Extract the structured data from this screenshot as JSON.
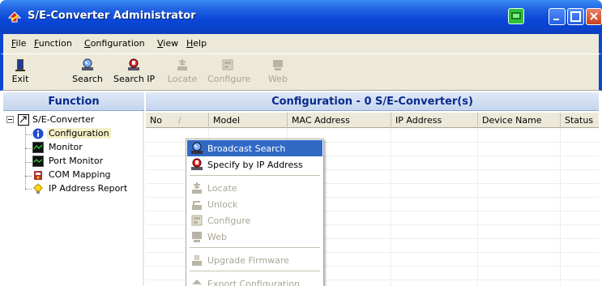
{
  "window": {
    "title": "S/E-Converter Administrator"
  },
  "menubar": {
    "items": [
      {
        "label": "File",
        "mnemonic": "F",
        "rest": "ile"
      },
      {
        "label": "Function",
        "mnemonic": "F",
        "rest": "unction"
      },
      {
        "label": "Configuration",
        "mnemonic": "C",
        "rest": "onfiguration"
      },
      {
        "label": "View",
        "mnemonic": "V",
        "rest": "iew"
      },
      {
        "label": "Help",
        "mnemonic": "H",
        "rest": "elp"
      }
    ]
  },
  "toolbar": {
    "buttons": [
      {
        "label": "Exit",
        "icon": "exit-icon",
        "enabled": true
      },
      {
        "label": "Search",
        "icon": "search-icon",
        "enabled": true
      },
      {
        "label": "Search IP",
        "icon": "search-ip-icon",
        "enabled": true
      },
      {
        "label": "Locate",
        "icon": "locate-icon",
        "enabled": false
      },
      {
        "label": "Configure",
        "icon": "configure-icon",
        "enabled": false
      },
      {
        "label": "Web",
        "icon": "web-icon",
        "enabled": false
      }
    ]
  },
  "function_pane": {
    "header": "Function",
    "tree": {
      "root": "S/E-Converter",
      "items": [
        {
          "label": "Configuration",
          "icon": "info-icon",
          "selected": true
        },
        {
          "label": "Monitor",
          "icon": "monitor-icon",
          "selected": false
        },
        {
          "label": "Port Monitor",
          "icon": "port-monitor-icon",
          "selected": false
        },
        {
          "label": "COM Mapping",
          "icon": "com-mapping-icon",
          "selected": false
        },
        {
          "label": "IP Address Report",
          "icon": "ip-report-icon",
          "selected": false
        }
      ]
    }
  },
  "config_pane": {
    "header": "Configuration - 0 S/E-Converter(s)",
    "columns": [
      "No",
      "Model",
      "MAC Address",
      "IP Address",
      "Device Name",
      "Status"
    ],
    "sort_indicator": "/"
  },
  "context_menu": {
    "items": [
      {
        "label": "Broadcast Search",
        "icon": "broadcast-search-icon",
        "enabled": true,
        "highlighted": true
      },
      {
        "label": "Specify by IP Address",
        "icon": "specify-ip-icon",
        "enabled": true,
        "highlighted": false
      },
      {
        "label": "Locate",
        "icon": "locate-icon",
        "enabled": false,
        "highlighted": false
      },
      {
        "label": "Unlock",
        "icon": "unlock-icon",
        "enabled": false,
        "highlighted": false
      },
      {
        "label": "Configure",
        "icon": "configure-icon",
        "enabled": false,
        "highlighted": false
      },
      {
        "label": "Web",
        "icon": "web-icon",
        "enabled": false,
        "highlighted": false
      },
      {
        "label": "Upgrade Firmware",
        "icon": "upgrade-firmware-icon",
        "enabled": false,
        "highlighted": false
      },
      {
        "label": "Export Configuration",
        "icon": "export-config-icon",
        "enabled": false,
        "highlighted": false
      }
    ]
  },
  "colors": {
    "titlebar": "#0a46d8",
    "pane_header_text": "#0b2a8c",
    "menu_highlight": "#316ac5",
    "disabled_text": "#a8a596"
  }
}
